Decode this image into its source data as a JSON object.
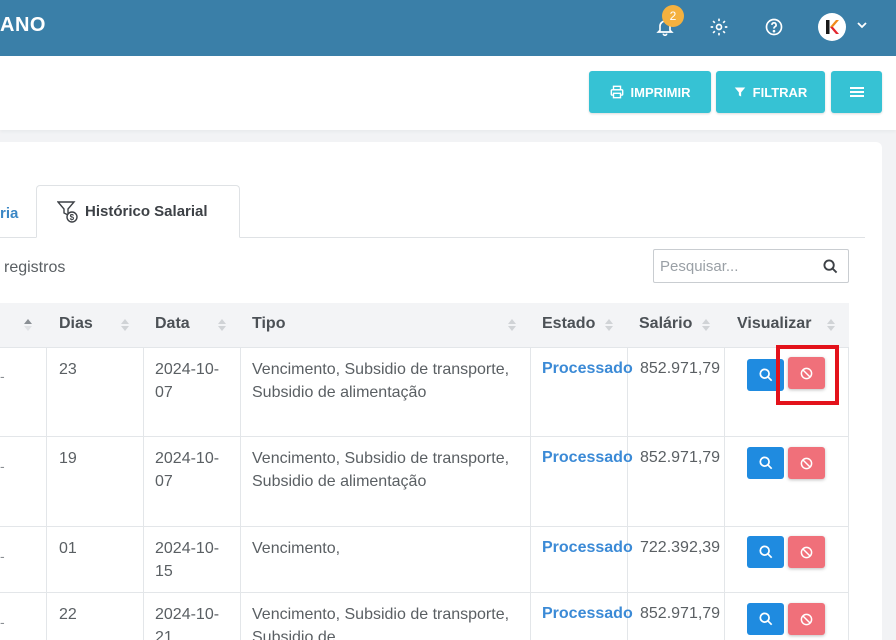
{
  "header": {
    "brand": "ANO",
    "notifications_count": "2",
    "icons": [
      "bell-icon",
      "gear-icon",
      "help-icon",
      "avatar",
      "chevron-down-icon"
    ],
    "color": "#3a7fa8"
  },
  "toolbar": {
    "print_label": "IMPRIMIR",
    "filter_label": "FILTRAR",
    "accent": "#36c2d4"
  },
  "tabs": {
    "left_partial": "ria",
    "active": "Histórico Salarial"
  },
  "table_info": {
    "registros": "registros",
    "search_placeholder": "Pesquisar..."
  },
  "table": {
    "columns": [
      "Dias",
      "Data",
      "Tipo",
      "Estado",
      "Salário",
      "Visualizar"
    ],
    "rows": [
      {
        "dias": "23",
        "data": "2024-10-07",
        "tipo": "Vencimento, Subsidio de transporte, Subsidio de alimentação",
        "estado": "Processado",
        "salario": "852.971,79"
      },
      {
        "dias": "19",
        "data": "2024-10-07",
        "tipo": "Vencimento, Subsidio de transporte, Subsidio de alimentação",
        "estado": "Processado",
        "salario": "852.971,79"
      },
      {
        "dias": "01",
        "data": "2024-10-15",
        "tipo": "Vencimento,",
        "estado": "Processado",
        "salario": "722.392,39"
      },
      {
        "dias": "22",
        "data": "2024-10-21",
        "tipo": "Vencimento, Subsidio de transporte, Subsidio de",
        "estado": "Processado",
        "salario": "852.971,79"
      }
    ]
  },
  "colors": {
    "estado": "#3b8ad6",
    "view_button": "#1f8be0",
    "cancel_button": "#f0707a",
    "highlight": "#e3121b"
  }
}
